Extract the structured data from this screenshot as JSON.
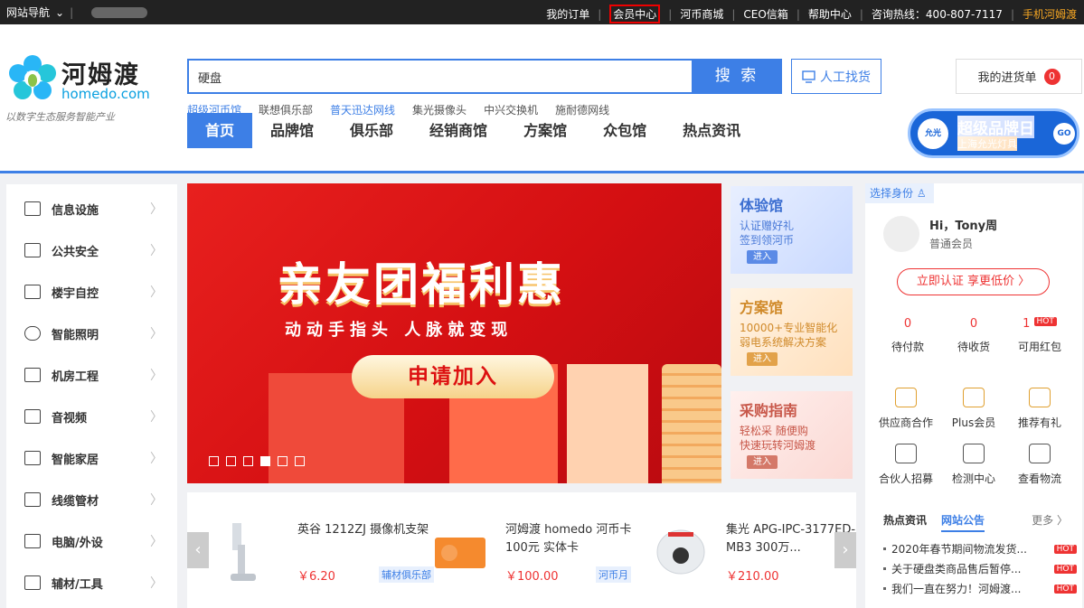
{
  "topbar": {
    "site_nav": "网站导航",
    "links": [
      "我的订单",
      "会员中心",
      "河币商城",
      "CEO信箱",
      "帮助中心",
      "咨询热线：400-807-7117"
    ],
    "mobile": "手机河姆渡"
  },
  "logo": {
    "cn": "河姆渡",
    "en": "homedo.com",
    "slogan": "以数字生态服务智能产业"
  },
  "search": {
    "value": "硬盘",
    "button": "搜 索"
  },
  "manual": "人工找货",
  "cart": {
    "label": "我的进货单",
    "count": "0"
  },
  "hotwords": [
    "超级河币馆",
    "联想俱乐部",
    "普天迅达网线",
    "集光摄像头",
    "中兴交换机",
    "施耐德网线"
  ],
  "nav": [
    "首页",
    "品牌馆",
    "俱乐部",
    "经销商馆",
    "方案馆",
    "众包馆",
    "热点资讯"
  ],
  "promo": {
    "logo": "允光",
    "title": "超级品牌日",
    "subtitle": "上海允光灯具",
    "go": "GO"
  },
  "categories": [
    "信息设施",
    "公共安全",
    "楼宇自控",
    "智能照明",
    "机房工程",
    "音视频",
    "智能家居",
    "线缆管材",
    "电脑/外设",
    "辅材/工具"
  ],
  "banner": {
    "headline": "亲友团福利惠",
    "sub": "动动手指头  人脉就变现",
    "cta": "申请加入",
    "slides": 6,
    "active_slide": 4
  },
  "tiles": [
    {
      "title": "体验馆",
      "lines": [
        "认证赠好礼",
        "签到领河币"
      ],
      "enter": "进入"
    },
    {
      "title": "方案馆",
      "lines": [
        "10000+专业智能化",
        "弱电系统解决方案"
      ],
      "enter": "进入"
    },
    {
      "title": "采购指南",
      "lines": [
        "轻松采 随便购",
        "快速玩转河姆渡"
      ],
      "enter": "进入"
    }
  ],
  "products": [
    {
      "name": "英谷 1212ZJ 摄像机支架",
      "price": "￥6.20",
      "tag": "辅材俱乐部"
    },
    {
      "name": "河姆渡 homedo 河币卡 100元 实体卡",
      "price": "￥100.00",
      "tag": "河币月"
    },
    {
      "name": "集光 APG-IPC-3177ED-MB3 300万...",
      "price": "￥210.00",
      "tag": ""
    }
  ],
  "user": {
    "role": "选择身份",
    "greeting": "Hi，Tony周",
    "level": "普通会员",
    "verify": "立即认证 享更低价 〉",
    "stats": [
      {
        "n": "0",
        "l": "待付款"
      },
      {
        "n": "0",
        "l": "待收货"
      },
      {
        "n": "1",
        "l": "可用红包"
      }
    ],
    "hot": "HOT",
    "services": [
      "供应商合作",
      "Plus会员",
      "推荐有礼",
      "合伙人招募",
      "检测中心",
      "查看物流"
    ],
    "tabs": [
      "热点资讯",
      "网站公告"
    ],
    "more": "更多 〉",
    "notices": [
      "2020年春节期间物流发货...",
      "关于硬盘类商品售后暂停...",
      "我们一直在努力！河姆渡..."
    ]
  }
}
